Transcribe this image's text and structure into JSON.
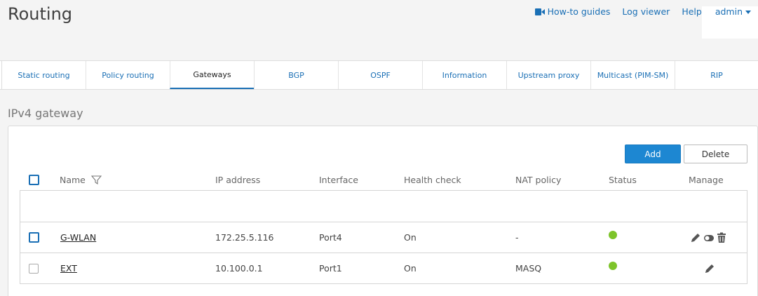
{
  "page": {
    "title": "Routing"
  },
  "top_links": {
    "howto": "How-to guides",
    "log_viewer": "Log viewer",
    "help": "Help",
    "admin": "admin"
  },
  "tabs": [
    {
      "label": "Static routing"
    },
    {
      "label": "Policy routing"
    },
    {
      "label": "Gateways",
      "active": true
    },
    {
      "label": "BGP"
    },
    {
      "label": "OSPF"
    },
    {
      "label": "Information"
    },
    {
      "label": "Upstream proxy"
    },
    {
      "label": "Multicast (PIM-SM)"
    },
    {
      "label": "RIP"
    }
  ],
  "section": {
    "title": "IPv4 gateway"
  },
  "toolbar": {
    "add_label": "Add",
    "delete_label": "Delete"
  },
  "table": {
    "columns": {
      "name": "Name",
      "ip": "IP address",
      "interface": "Interface",
      "health": "Health check",
      "nat": "NAT policy",
      "status": "Status",
      "manage": "Manage"
    },
    "rows": [
      {
        "name": "G-WLAN",
        "ip": "172.25.5.116",
        "interface": "Port4",
        "health": "On",
        "nat": "-",
        "status": "active",
        "manage_icons": [
          "edit-icon",
          "toggle-icon",
          "trash-icon"
        ]
      },
      {
        "name": "EXT",
        "ip": "10.100.0.1",
        "interface": "Port1",
        "health": "On",
        "nat": "MASQ",
        "status": "active",
        "manage_icons": [
          "edit-icon"
        ]
      }
    ]
  },
  "colors": {
    "accent": "#1a6fb5",
    "status_active": "#7dc42a",
    "primary_button": "#1d87d2"
  }
}
